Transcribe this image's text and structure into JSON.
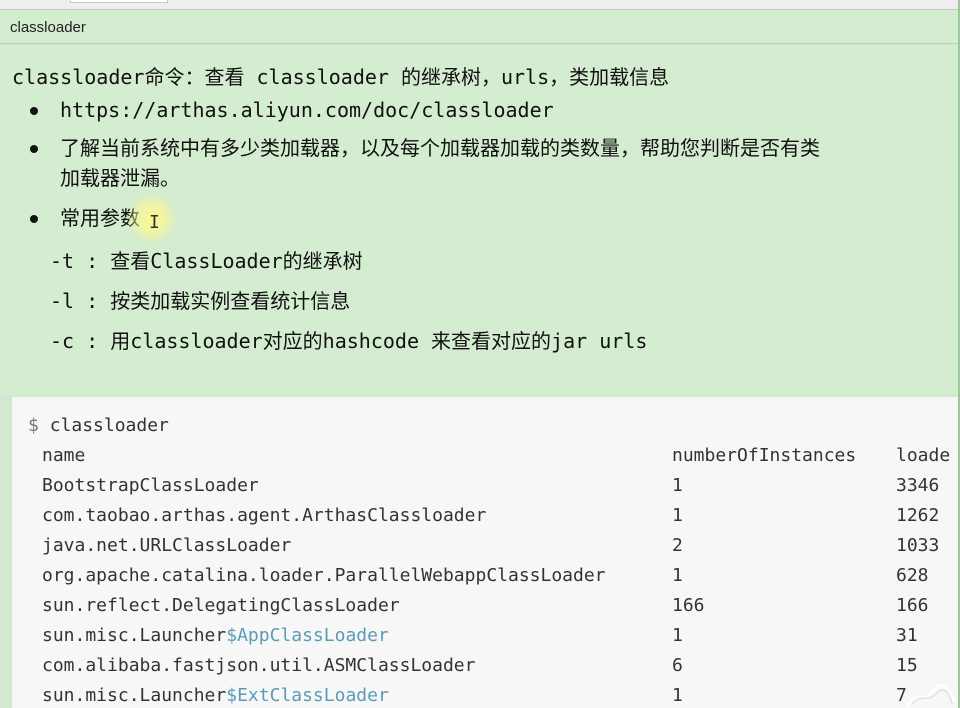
{
  "window": {
    "title": "classloader"
  },
  "headline": "classloader命令：查看 classloader 的继承树，urls，类加载信息",
  "bullets": [
    {
      "text": "https://arthas.aliyun.com/doc/classloader"
    },
    {
      "line1": "了解当前系统中有多少类加载器，以及每个加载器加载的类数量，帮助您判断是否有类",
      "line2": "加载器泄漏。"
    },
    {
      "text": "常用参数"
    }
  ],
  "params": [
    {
      "flag": "-t",
      "sep": ":",
      "desc": "查看ClassLoader的继承树"
    },
    {
      "flag": "-l",
      "sep": ":",
      "desc": "按类加载实例查看统计信息"
    },
    {
      "flag": "-c",
      "sep": ":",
      "desc": "用classloader对应的hashcode 来查看对应的jar urls"
    }
  ],
  "code": {
    "prompt": "$",
    "command": "classloader",
    "headers": [
      "name",
      "numberOfInstances",
      "loade"
    ],
    "rows": [
      {
        "name": "BootstrapClassLoader",
        "instances": "1",
        "loaded": "3346"
      },
      {
        "name": "com.taobao.arthas.agent.ArthasClassloader",
        "instances": "1",
        "loaded": "1262"
      },
      {
        "name": "java.net.URLClassLoader",
        "instances": "2",
        "loaded": "1033"
      },
      {
        "name": "org.apache.catalina.loader.ParallelWebappClassLoader",
        "instances": "1",
        "loaded": "628"
      },
      {
        "name": "sun.reflect.DelegatingClassLoader",
        "instances": "166",
        "loaded": "166"
      },
      {
        "name": "sun.misc.Launcher",
        "suffix": "$AppClassLoader",
        "instances": "1",
        "loaded": "31"
      },
      {
        "name": "com.alibaba.fastjson.util.ASMClassLoader",
        "instances": "6",
        "loaded": "15"
      },
      {
        "name": "sun.misc.Launcher",
        "suffix": "$ExtClassLoader",
        "instances": "1",
        "loaded": "7"
      }
    ]
  },
  "colors": {
    "panel": "#d4eccf",
    "code_bg": "#f7f7f7",
    "accent": "#5a9bb5"
  },
  "icons": {
    "cursor": "text-cursor-icon",
    "corner": "corner-ornament-icon"
  }
}
